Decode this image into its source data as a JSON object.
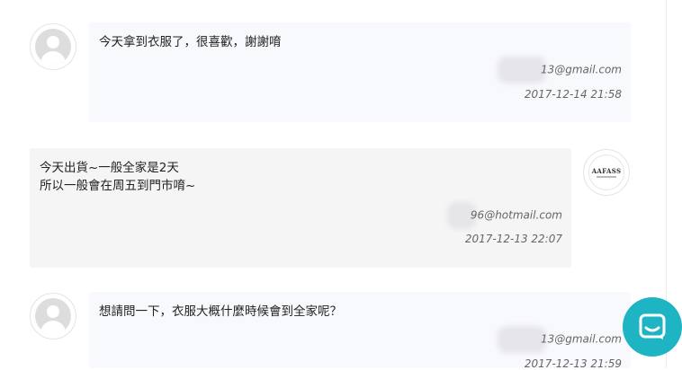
{
  "comments": [
    {
      "author": "customer",
      "text_lines": [
        "今天拿到衣服了，很喜歡，謝謝唷"
      ],
      "email_visible": "13@gmail.com",
      "timestamp": "2017-12-14 21:58"
    },
    {
      "author": "shop",
      "avatar_logo": "AAFASS",
      "text_lines": [
        "今天出貨~一般全家是2天",
        "所以一般會在周五到門市唷~"
      ],
      "email_visible": "96@hotmail.com",
      "timestamp": "2017-12-13 22:07"
    },
    {
      "author": "customer",
      "text_lines": [
        "想請問一下，衣服大概什麼時候會到全家呢？"
      ],
      "email_visible": "13@gmail.com",
      "timestamp": "2017-12-13 21:59"
    }
  ],
  "colors": {
    "chat_button": "#1fb4c4",
    "user_bubble": "#f8f9fc",
    "shop_bubble": "#f5f5f5"
  },
  "icons": {
    "default_avatar": "user-silhouette-icon",
    "chat_button": "chat-bubble-icon"
  }
}
